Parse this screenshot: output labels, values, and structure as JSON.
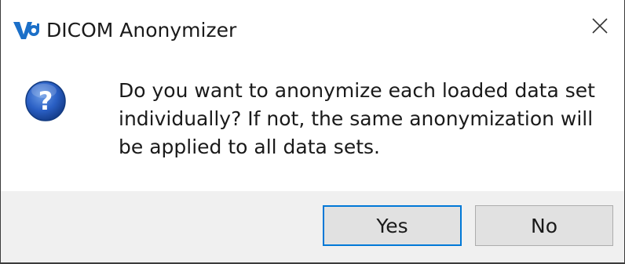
{
  "dialog": {
    "title": "DICOM Anonymizer",
    "app_icon": "dicom-anonymizer-logo-icon",
    "close_icon": "close-icon",
    "question_icon": "question-mark-icon",
    "message": "Do you want to anonymize each loaded data set\nindividually?  If not, the same anonymization will\nbe applied to all data sets.",
    "buttons": {
      "yes_label": "Yes",
      "no_label": "No"
    },
    "colors": {
      "accent": "#0078d7",
      "icon_blue": "#1b4fa8",
      "footer_bg": "#f0f0f0",
      "button_bg": "#e1e1e1"
    }
  }
}
